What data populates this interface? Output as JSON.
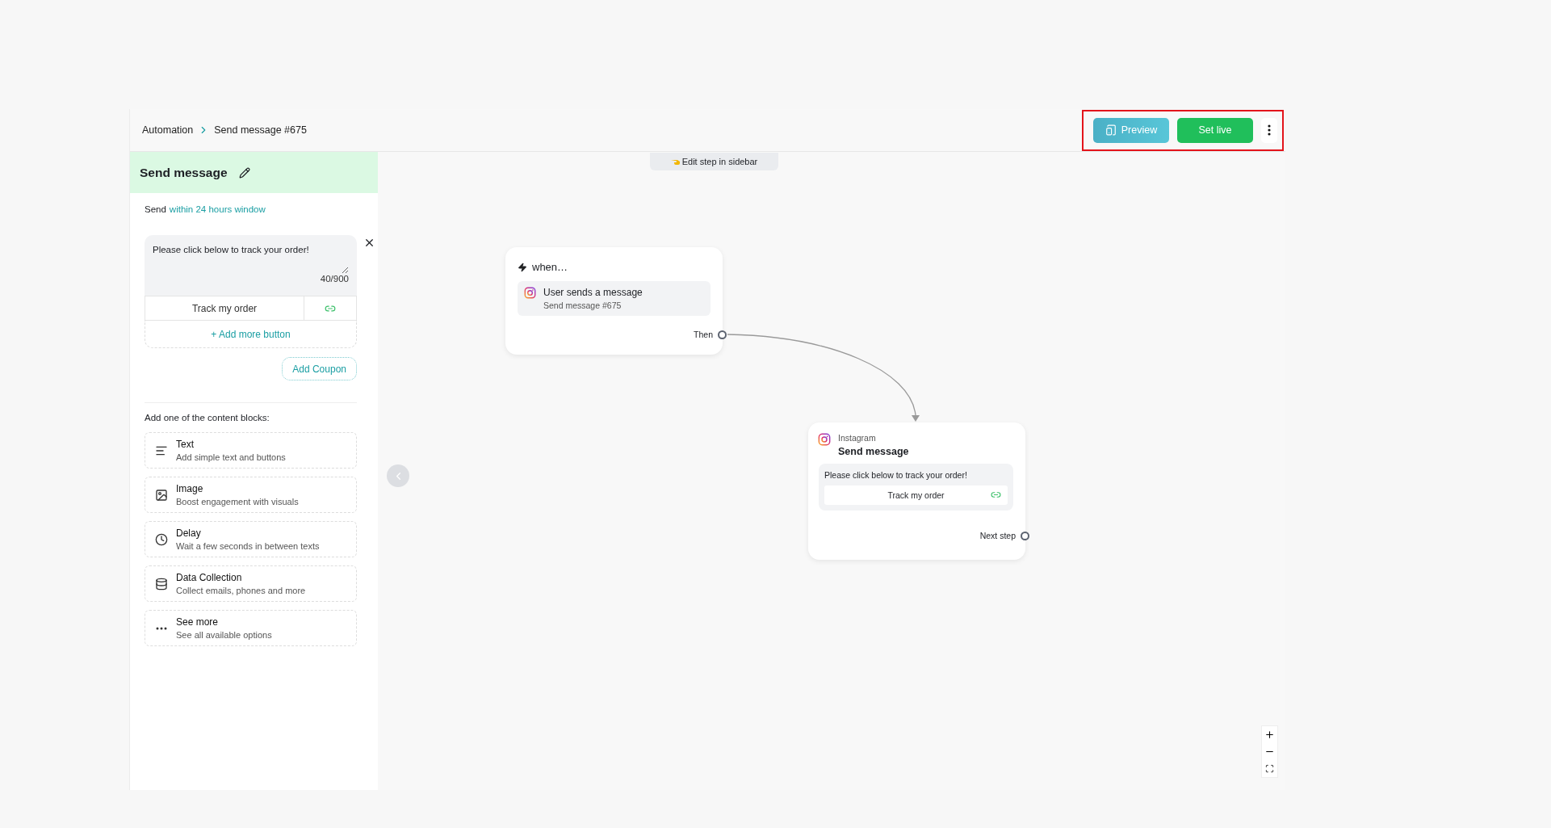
{
  "breadcrumb": [
    {
      "label": "Automation"
    },
    {
      "label": "Send message #675"
    }
  ],
  "actions": {
    "highlighted": true,
    "buttons": [
      {
        "kind": "preview",
        "label": "Preview"
      },
      {
        "kind": "primary",
        "label": "Set live"
      },
      {
        "kind": "more"
      }
    ]
  },
  "sidebar": {
    "title": "Send message",
    "send_prefix": "Send",
    "send_window_link": "within 24 hours window",
    "message": {
      "text": "Please click below to track your order!",
      "counter": "40/900",
      "buttons": [
        {
          "label": "Track my order"
        }
      ],
      "add_button": "+ Add more button",
      "coupon_button": "Add Coupon"
    },
    "blocks_heading": "Add one of the content blocks:",
    "blocks": [
      {
        "kind": "text",
        "title": "Text",
        "subtitle": "Add simple text and buttons"
      },
      {
        "kind": "image",
        "title": "Image",
        "subtitle": "Boost engagement with visuals"
      },
      {
        "kind": "delay",
        "title": "Delay",
        "subtitle": "Wait a few seconds in between texts"
      },
      {
        "kind": "data",
        "title": "Data Collection",
        "subtitle": "Collect emails, phones and more"
      },
      {
        "kind": "more",
        "title": "See more",
        "subtitle": "See all available options"
      }
    ]
  },
  "canvas": {
    "hint": "Edit step in sidebar",
    "trigger": {
      "heading": "when…",
      "event": "User sends a message",
      "source": "Send message #675",
      "output": "Then"
    },
    "step": {
      "channel": "Instagram",
      "title": "Send message",
      "message": "Please click below to track your order!",
      "buttons": [
        {
          "label": "Track my order"
        }
      ],
      "output": "Next step"
    }
  }
}
